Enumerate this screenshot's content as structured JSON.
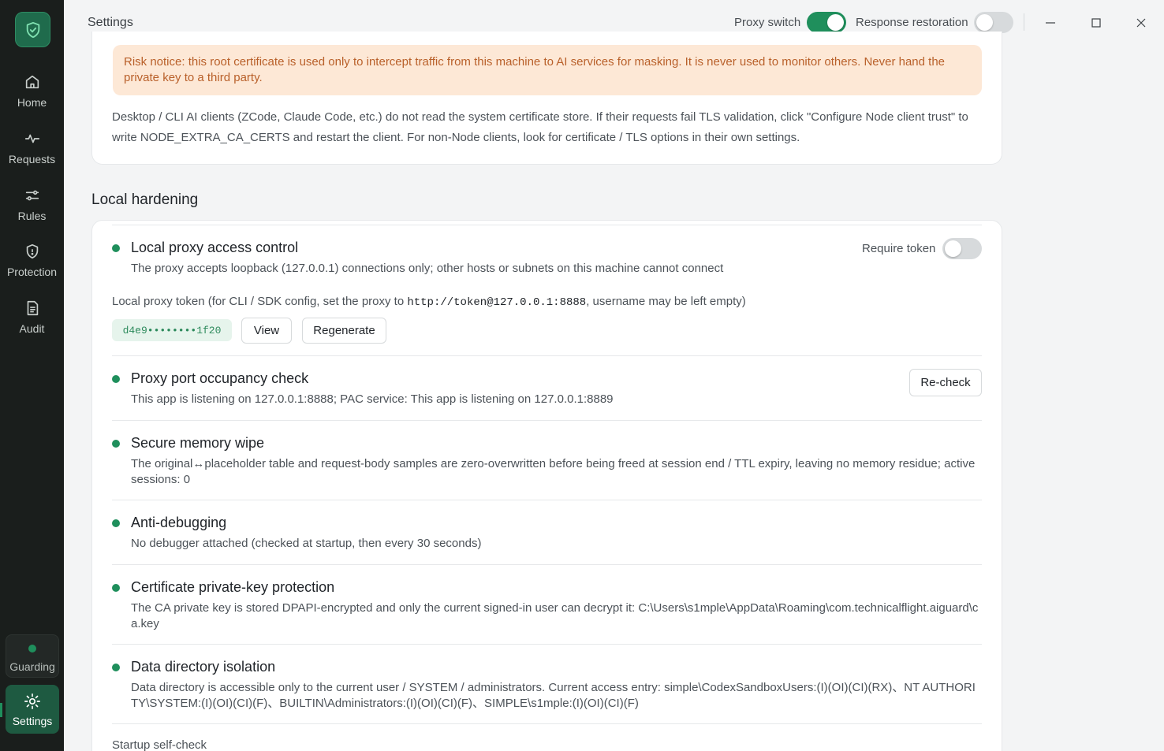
{
  "sidebar": {
    "items": [
      {
        "label": "Home",
        "icon": "home-icon"
      },
      {
        "label": "Requests",
        "icon": "activity-icon"
      },
      {
        "label": "Rules",
        "icon": "sliders-icon"
      },
      {
        "label": "Protection",
        "icon": "shield-icon"
      },
      {
        "label": "Audit",
        "icon": "document-icon"
      }
    ],
    "status_label": "Guarding",
    "settings_label": "Settings",
    "accent": "#1f8f5c"
  },
  "titlebar": {
    "title": "Settings",
    "proxy_switch_label": "Proxy switch",
    "proxy_switch_on": true,
    "response_restoration_label": "Response restoration",
    "response_restoration_on": false
  },
  "certificate": {
    "risk_notice": "Risk notice: this root certificate is used only to intercept traffic from this machine to AI services for masking. It is never used to monitor others. Never hand the private key to a third party.",
    "client_note": "Desktop / CLI AI clients (ZCode, Claude Code, etc.) do not read the system certificate store. If their requests fail TLS validation, click \"Configure Node client trust\" to write NODE_EXTRA_CA_CERTS and restart the client. For non-Node clients, look for certificate / TLS options in their own settings."
  },
  "hardening": {
    "section_title": "Local hardening",
    "access_control": {
      "title": "Local proxy access control",
      "desc": "The proxy accepts loopback (127.0.0.1) connections only; other hosts or subnets on this machine cannot connect",
      "require_token_label": "Require token",
      "require_token_on": false,
      "token_hint_prefix": "Local proxy token (for CLI / SDK config, set the proxy to ",
      "token_hint_url": "http://token@127.0.0.1:8888",
      "token_hint_suffix": ", username may be left empty)",
      "token_masked": "d4e9••••••••1f20",
      "view_label": "View",
      "regenerate_label": "Regenerate"
    },
    "port_check": {
      "title": "Proxy port occupancy check",
      "desc": "This app is listening on 127.0.0.1:8888; PAC service: This app is listening on 127.0.0.1:8889",
      "recheck_label": "Re-check"
    },
    "memory_wipe": {
      "title": "Secure memory wipe",
      "desc": "The original↔placeholder table and request-body samples are zero-overwritten before being freed at session end / TTL expiry, leaving no memory residue; active sessions: 0"
    },
    "anti_debug": {
      "title": "Anti-debugging",
      "desc": "No debugger attached (checked at startup, then every 30 seconds)"
    },
    "cert_key": {
      "title": "Certificate private-key protection",
      "desc": "The CA private key is stored DPAPI-encrypted and only the current signed-in user can decrypt it: C:\\Users\\s1mple\\AppData\\Roaming\\com.technicalflight.aiguard\\ca.key"
    },
    "data_dir": {
      "title": "Data directory isolation",
      "desc": "Data directory is accessible only to the current user / SYSTEM / administrators. Current access entry: simple\\CodexSandboxUsers:(I)(OI)(CI)(RX)、NT AUTHORITY\\SYSTEM:(I)(OI)(CI)(F)、BUILTIN\\Administrators:(I)(OI)(CI)(F)、SIMPLE\\s1mple:(I)(OI)(CI)(F)"
    },
    "startup_check_label": "Startup self-check"
  }
}
